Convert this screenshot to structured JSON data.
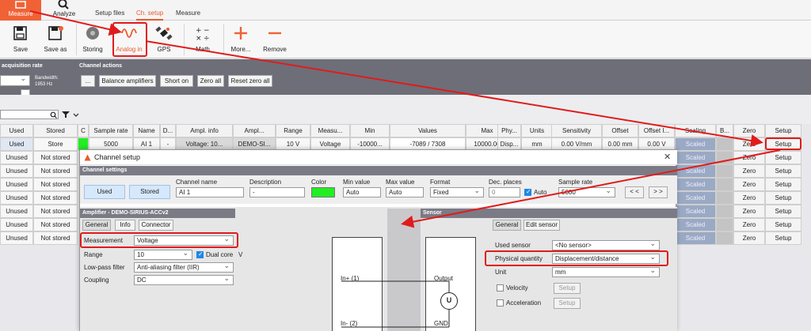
{
  "tabs": {
    "measure": "Measure",
    "analyze": "Analyze",
    "setup_files": "Setup files",
    "ch_setup": "Ch. setup",
    "measure2": "Measure"
  },
  "ribbon": {
    "save": "Save",
    "save_as": "Save as",
    "storing": "Storing",
    "analog_in": "Analog in",
    "gps": "GPS",
    "math": "Math",
    "more": "More...",
    "remove": "Remove"
  },
  "actions": {
    "acq_header": "acquisition rate",
    "bandwidth": "Bandwidth:",
    "bandwidth_value": "1953 Hz",
    "channel_actions_header": "Channel actions",
    "dots": "...",
    "balance": "Balance amplifiers",
    "short_on": "Short on",
    "zero_all": "Zero all",
    "reset_zero_all": "Reset zero all"
  },
  "table": {
    "headers": [
      "Used",
      "Stored",
      "C",
      "Sample rate",
      "Name",
      "D...",
      "Ampl. info",
      "Ampl...",
      "Range",
      "Measu...",
      "Min",
      "Values",
      "Max",
      "Phy...",
      "Units",
      "Sensitivity",
      "Offset",
      "Offset I...",
      "Scaling",
      "B...",
      "Zero",
      "Setup"
    ],
    "first_row": {
      "used": "Used",
      "stored": "Store",
      "sample_rate": "5000",
      "name": "AI 1",
      "desc": "-",
      "ampl_info": "Voltage: 10...",
      "ampl": "DEMO-SI...",
      "range": "10 V",
      "measu": "Voltage",
      "min": "-10000...",
      "values": "-7089 / 7308",
      "max": "10000.00",
      "phy": "Disp...",
      "units": "mm",
      "sensitivity": "0.00 V/mm",
      "offset": "0.00 mm",
      "offset_i": "0.00 V",
      "scaling": "Scaled",
      "zero": "Zero",
      "setup": "Setup"
    },
    "rows": [
      {
        "used": "Unused",
        "stored": "Not stored",
        "scaling": "Scaled",
        "zero": "Zero",
        "setup": "Setup"
      },
      {
        "used": "Unused",
        "stored": "Not stored",
        "scaling": "Scaled",
        "zero": "Zero",
        "setup": "Setup"
      },
      {
        "used": "Unused",
        "stored": "Not stored",
        "scaling": "Scaled",
        "zero": "Zero",
        "setup": "Setup"
      },
      {
        "used": "Unused",
        "stored": "Not stored",
        "scaling": "Scaled",
        "zero": "Zero",
        "setup": "Setup"
      },
      {
        "used": "Unused",
        "stored": "Not stored",
        "scaling": "Scaled",
        "zero": "Zero",
        "setup": "Setup"
      },
      {
        "used": "Unused",
        "stored": "Not stored",
        "scaling": "Scaled",
        "zero": "Zero",
        "setup": "Setup"
      },
      {
        "used": "Unused",
        "stored": "Not stored",
        "scaling": "Scaled",
        "zero": "Zero",
        "setup": "Setup"
      }
    ]
  },
  "dialog": {
    "title": "Channel setup",
    "close": "✕",
    "channel_settings": "Channel settings",
    "used": "Used",
    "stored": "Stored",
    "channel_name_label": "Channel name",
    "channel_name": "AI 1",
    "description_label": "Description",
    "description": "-",
    "color_label": "Color",
    "color": "#22ee22",
    "min_label": "Min value",
    "min_value": "Auto",
    "max_label": "Max value",
    "max_value": "Auto",
    "format_label": "Format",
    "format": "Fixed",
    "dec_label": "Dec. places",
    "dec_value": "0",
    "auto": "Auto",
    "sample_rate_label": "Sample rate",
    "sample_rate": "5000",
    "prev": "< <",
    "next": "> >",
    "amplifier_header": "Amplifier - DEMO-SIRIUS-ACCv2",
    "amp_tabs": [
      "General",
      "Info",
      "Connector"
    ],
    "measurement_label": "Measurement",
    "measurement": "Voltage",
    "range_label": "Range",
    "range": "10",
    "dual_core": "Dual core",
    "v": "V",
    "lowpass_label": "Low-pass filter",
    "lowpass": "Anti-aliasing filter (IIR)",
    "coupling_label": "Coupling",
    "coupling": "DC",
    "in_plus": "In+ (1)",
    "in_minus": "In- (2)",
    "output": "Output",
    "gnd": "GND",
    "u": "U",
    "sensor_header": "Sensor",
    "sensor_tabs": [
      "General",
      "Edit sensor"
    ],
    "used_sensor_label": "Used sensor",
    "used_sensor": "<No sensor>",
    "phys_label": "Physical quantity",
    "phys": "Displacement/distance",
    "unit_label": "Unit",
    "unit": "mm",
    "velocity": "Velocity",
    "acceleration": "Acceleration",
    "setup_btn": "Setup"
  },
  "colors": {
    "accent": "#f06236",
    "highlight": "#e01b1b",
    "scaled": "#9aa9c4"
  }
}
